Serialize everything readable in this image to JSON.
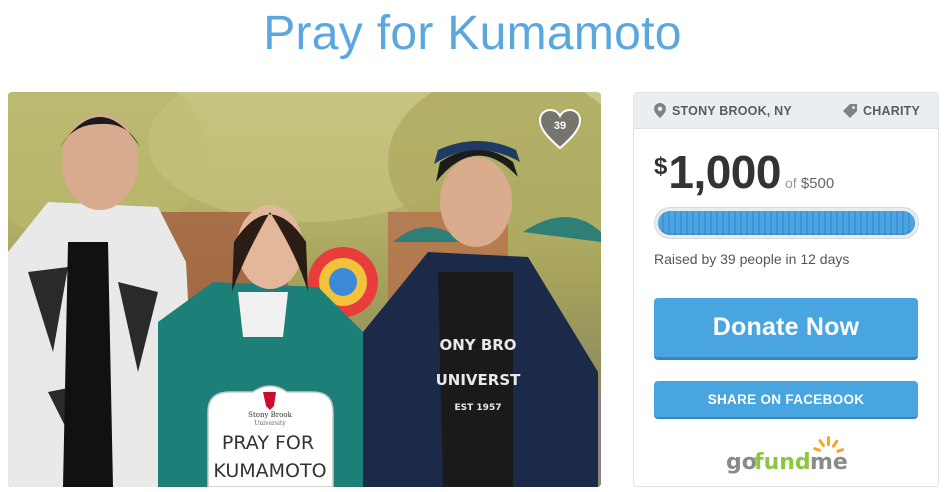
{
  "page": {
    "title": "Pray for Kumamoto"
  },
  "photo": {
    "alt": "Three students holding a Pray for Kumamoto sign",
    "sign_header": "Stony Brook",
    "sign_subheader": "University",
    "sign_line1": "PRAY FOR",
    "sign_line2": "KUMAMOTO",
    "shirt_line1": "ONY BRO",
    "shirt_line2": "UNIVERST",
    "shirt_line3": "EST 1957"
  },
  "heart": {
    "count": "39",
    "color": "#6e6e6e"
  },
  "campaign": {
    "location": "STONY BROOK, NY",
    "category": "CHARITY",
    "currency_symbol": "$",
    "raised": "1,000",
    "goal_prefix": "of",
    "goal": "$500",
    "progress_fraction": 1.0,
    "raised_by_text": "Raised by 39 people in 12 days",
    "donate_label": "Donate Now",
    "share_label": "SHARE ON FACEBOOK",
    "logo_text_go": "go",
    "logo_text_fund": "fund",
    "logo_text_me": "me",
    "colors": {
      "accent": "#49a5e0",
      "title": "#5aa7de",
      "logo_green": "#8dc63f",
      "logo_orange": "#f6a623"
    }
  }
}
